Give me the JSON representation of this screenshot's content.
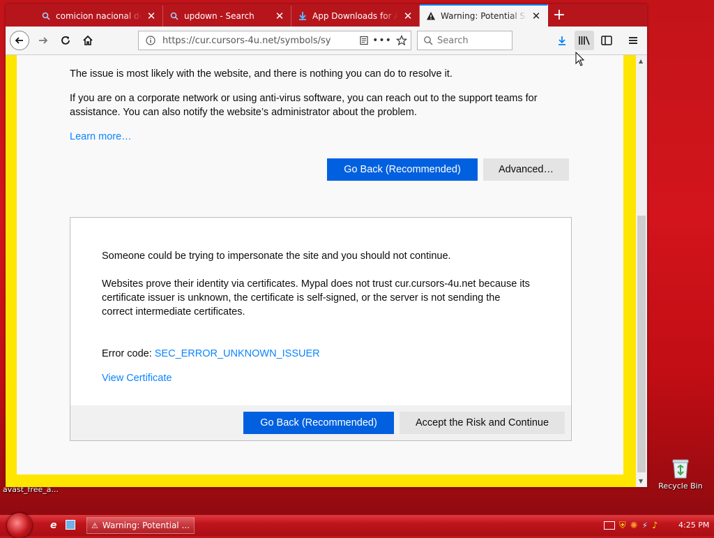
{
  "browser": {
    "tabs": [
      {
        "title": "comicion nacional de te",
        "icon": "search-icon"
      },
      {
        "title": "updown - Search",
        "icon": "search-icon"
      },
      {
        "title": "App Downloads for Andr",
        "icon": "download-site-icon"
      },
      {
        "title": "Warning: Potential Secu",
        "icon": "warning-icon",
        "active": true
      }
    ],
    "url": "https://cur.cursors-4u.net/symbols/sy",
    "search_placeholder": "Search"
  },
  "page": {
    "para1": "The issue is most likely with the website, and there is nothing you can do to resolve it.",
    "para2_line1": "If you are on a corporate network or using anti-virus software, you can reach out to the support teams for",
    "para2_line2": "assistance. You can also notify the website’s administrator about the problem.",
    "learn_more": "Learn more…",
    "go_back_label": "Go Back (Recommended)",
    "advanced_label": "Advanced…",
    "advanced": {
      "line1": "Someone could be trying to impersonate the site and you should not continue.",
      "line2a": "Websites prove their identity via certificates. Mypal does not trust cur.cursors-4u.net because its",
      "line2b": "certificate issuer is unknown, the certificate is self-signed, or the server is not sending the",
      "line2c": "correct intermediate certificates.",
      "error_prefix": "Error code: ",
      "error_code": "SEC_ERROR_UNKNOWN_ISSUER",
      "view_certificate": "View Certificate",
      "go_back_label": "Go Back (Recommended)",
      "accept_label": "Accept the Risk and Continue"
    }
  },
  "desktop": {
    "left_icon_label": "avast_free_a...",
    "recycle_bin_label": "Recycle Bin"
  },
  "taskbar": {
    "task_label": "Warning: Potential ...",
    "clock": "4:25 PM"
  },
  "colors": {
    "accent": "#0a84ff",
    "primary_button": "#0060df",
    "page_border": "#ffe600",
    "desktop": "#c3141a"
  }
}
